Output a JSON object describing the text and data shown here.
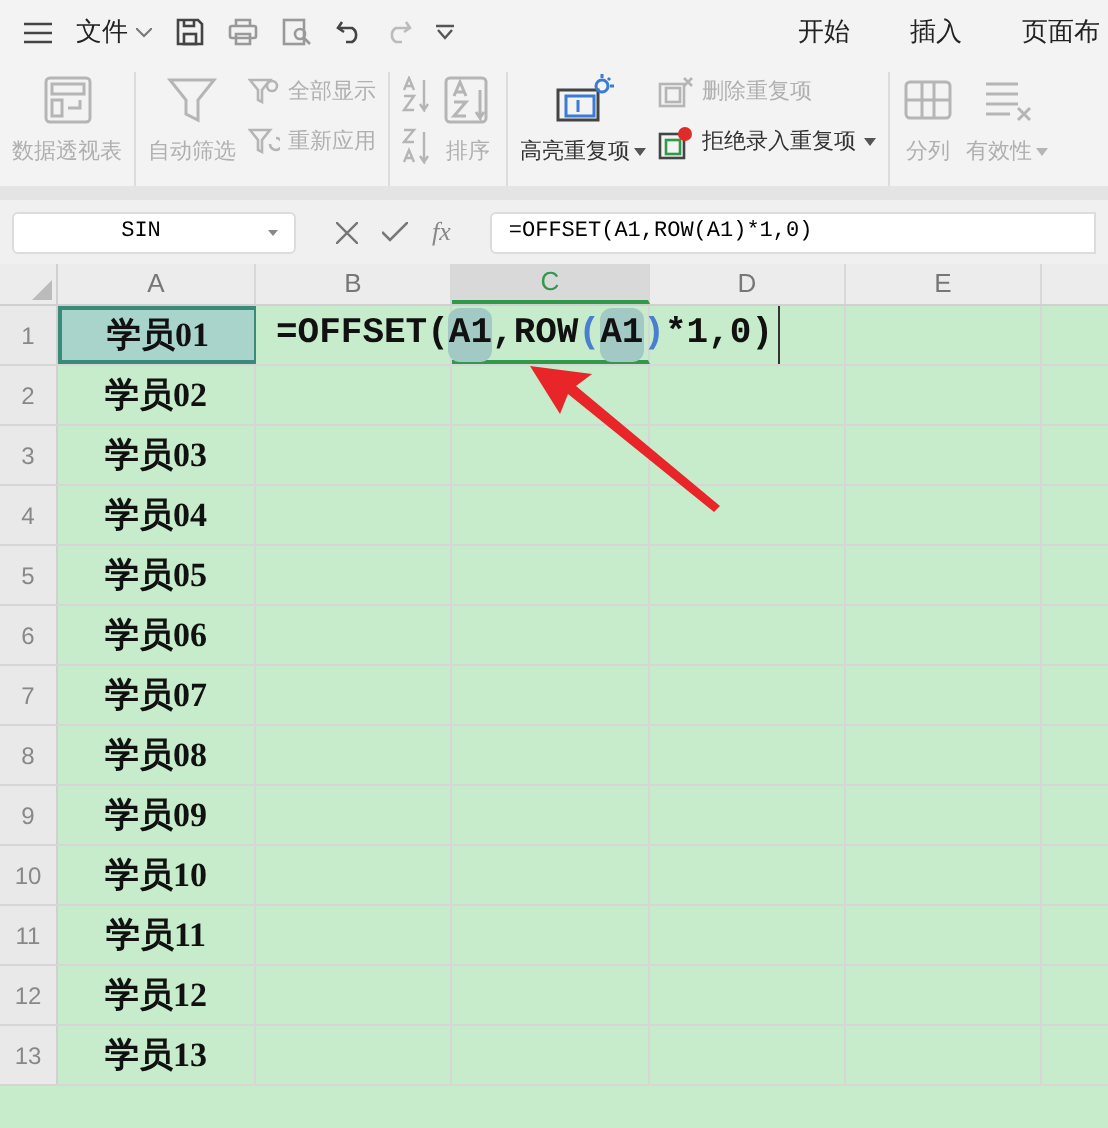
{
  "top_bar": {
    "file_menu": "文件",
    "tabs": [
      {
        "label": "开始"
      },
      {
        "label": "插入"
      },
      {
        "label": "页面布"
      }
    ]
  },
  "ribbon": {
    "groups": [
      {
        "items": [
          {
            "kind": "large",
            "label": "数据透视表",
            "disabled": true,
            "dropdown": false
          }
        ]
      },
      {
        "items": [
          {
            "kind": "large",
            "label": "自动筛选",
            "disabled": true,
            "dropdown": false
          },
          {
            "kind": "stack",
            "entries": [
              {
                "label": "全部显示",
                "disabled": true,
                "dropdown": false
              },
              {
                "label": "重新应用",
                "disabled": true,
                "dropdown": false
              }
            ]
          }
        ]
      },
      {
        "items": [
          {
            "kind": "sort_pair",
            "disabled": true
          },
          {
            "kind": "large",
            "label": "排序",
            "disabled": true,
            "dropdown": false
          }
        ]
      },
      {
        "items": [
          {
            "kind": "large",
            "label": "高亮重复项",
            "disabled": false,
            "dropdown": true
          },
          {
            "kind": "stack",
            "entries": [
              {
                "label": "删除重复项",
                "disabled": true,
                "dropdown": false
              },
              {
                "label": "拒绝录入重复项",
                "disabled": false,
                "dropdown": true
              }
            ]
          }
        ]
      },
      {
        "items": [
          {
            "kind": "large",
            "label": "分列",
            "disabled": true,
            "dropdown": false
          },
          {
            "kind": "large",
            "label": "有效性",
            "disabled": true,
            "dropdown": true
          }
        ]
      }
    ]
  },
  "formula_bar": {
    "name_box": "SIN",
    "function_label": "fx",
    "formula": "=OFFSET(A1,ROW(A1)*1,0)"
  },
  "sheet": {
    "columns": [
      {
        "label": "A",
        "selected": false
      },
      {
        "label": "B",
        "selected": false
      },
      {
        "label": "C",
        "selected": true
      },
      {
        "label": "D",
        "selected": false
      },
      {
        "label": "E",
        "selected": false
      }
    ],
    "rows": [
      {
        "number": "1",
        "a": "学员01",
        "selected": true,
        "editor": [
          {
            "kind": "text",
            "text": "=OFFSET("
          },
          {
            "kind": "ref",
            "text": "A1"
          },
          {
            "kind": "text",
            "text": ",ROW"
          },
          {
            "kind": "paren",
            "text": "("
          },
          {
            "kind": "ref",
            "text": "A1"
          },
          {
            "kind": "paren",
            "text": ")"
          },
          {
            "kind": "text",
            "text": "*1,0)"
          }
        ]
      },
      {
        "number": "2",
        "a": "学员02",
        "selected": false
      },
      {
        "number": "3",
        "a": "学员03",
        "selected": false
      },
      {
        "number": "4",
        "a": "学员04",
        "selected": false
      },
      {
        "number": "5",
        "a": "学员05",
        "selected": false
      },
      {
        "number": "6",
        "a": "学员06",
        "selected": false
      },
      {
        "number": "7",
        "a": "学员07",
        "selected": false
      },
      {
        "number": "8",
        "a": "学员08",
        "selected": false
      },
      {
        "number": "9",
        "a": "学员09",
        "selected": false
      },
      {
        "number": "10",
        "a": "学员10",
        "selected": false
      },
      {
        "number": "11",
        "a": "学员11",
        "selected": false
      },
      {
        "number": "12",
        "a": "学员12",
        "selected": false
      },
      {
        "number": "13",
        "a": "学员13",
        "selected": false
      }
    ]
  }
}
